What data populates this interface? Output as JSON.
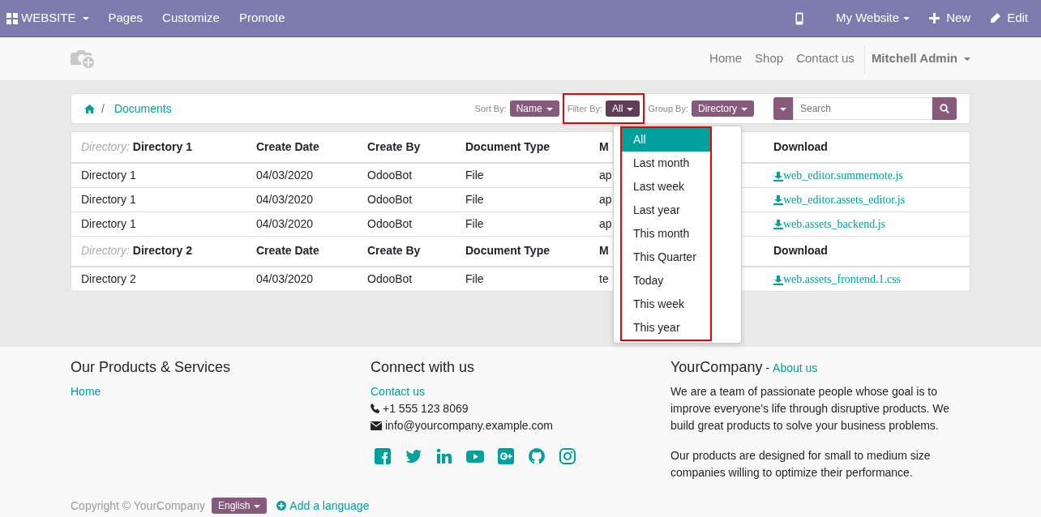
{
  "topbar": {
    "brand": "WEBSITE",
    "menu": [
      "Pages",
      "Customize",
      "Promote"
    ],
    "website": "My Website",
    "new": "New",
    "edit": "Edit"
  },
  "header": {
    "nav": [
      "Home",
      "Shop",
      "Contact us"
    ],
    "user": "Mitchell Admin"
  },
  "breadcrumb": {
    "separator": "/",
    "current": "Documents"
  },
  "controls": {
    "sort_label": "Sort By:",
    "sort_value": "Name",
    "filter_label": "Filter By:",
    "filter_value": "All",
    "group_label": "Group By:",
    "group_value": "Directory",
    "search_placeholder": "Search"
  },
  "filter_menu": {
    "expanded": true,
    "items": [
      {
        "label": "All",
        "selected": true
      },
      {
        "label": "Last month",
        "selected": false
      },
      {
        "label": "Last week",
        "selected": false
      },
      {
        "label": "Last year",
        "selected": false
      },
      {
        "label": "This month",
        "selected": false
      },
      {
        "label": "This Quarter",
        "selected": false
      },
      {
        "label": "Today",
        "selected": false
      },
      {
        "label": "This week",
        "selected": false
      },
      {
        "label": "This year",
        "selected": false
      }
    ]
  },
  "groups": [
    {
      "group_label": "Directory:",
      "group_name": "Directory 1",
      "columns": [
        "Create Date",
        "Create By",
        "Document Type",
        "M",
        "Download"
      ],
      "rows": [
        {
          "directory": "Directory 1",
          "create_date": "04/03/2020",
          "create_by": "OdooBot",
          "type": "File",
          "column_5": "ap",
          "download": "web_editor.summernote.js"
        },
        {
          "directory": "Directory 1",
          "create_date": "04/03/2020",
          "create_by": "OdooBot",
          "type": "File",
          "column_5": "ap",
          "download": "web_editor.assets_editor.js"
        },
        {
          "directory": "Directory 1",
          "create_date": "04/03/2020",
          "create_by": "OdooBot",
          "type": "File",
          "column_5": "ap",
          "download": "web.assets_backend.js"
        }
      ]
    },
    {
      "group_label": "Directory:",
      "group_name": "Directory 2",
      "columns": [
        "Create Date",
        "Create By",
        "Document Type",
        "M",
        "Download"
      ],
      "rows": [
        {
          "directory": "Directory 2",
          "create_date": "04/03/2020",
          "create_by": "OdooBot",
          "type": "File",
          "column_5": "te",
          "download": "web.assets_frontend.1.css"
        }
      ]
    }
  ],
  "footer": {
    "col1": {
      "title": "Our Products & Services",
      "links": [
        "Home"
      ]
    },
    "col2": {
      "title": "Connect with us",
      "link": "Contact us",
      "phone": "+1 555 123 8069",
      "email": "info@yourcompany.example.com"
    },
    "col3": {
      "title": "YourCompany",
      "separator": "-",
      "link": "About us",
      "paragraphs": [
        "We are a team of passionate people whose goal is to improve everyone's life through disruptive products. We build great products to solve your business problems.",
        "Our products are designed for small to medium size companies willing to optimize their performance."
      ]
    },
    "copyright": "Copyright © YourCompany",
    "language": "English",
    "add_language": "Add a language"
  }
}
